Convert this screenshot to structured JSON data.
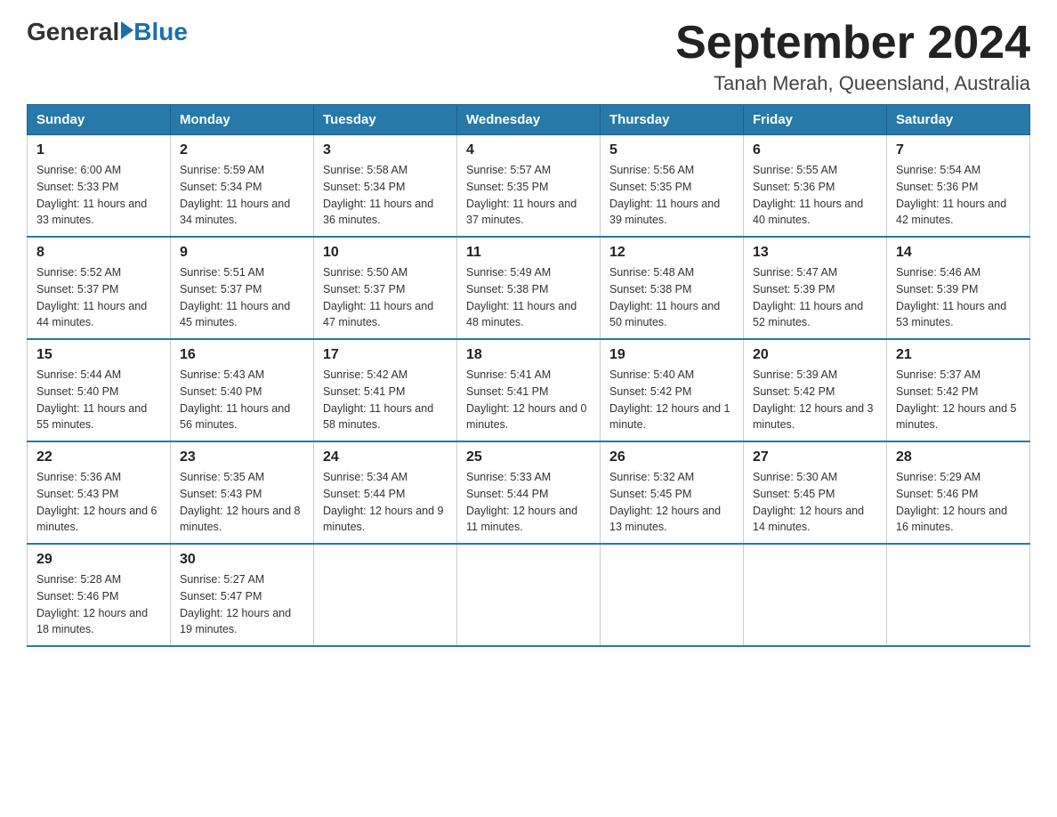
{
  "header": {
    "logo_general": "General",
    "logo_blue": "Blue",
    "month_title": "September 2024",
    "subtitle": "Tanah Merah, Queensland, Australia"
  },
  "calendar": {
    "days_of_week": [
      "Sunday",
      "Monday",
      "Tuesday",
      "Wednesday",
      "Thursday",
      "Friday",
      "Saturday"
    ],
    "weeks": [
      [
        null,
        null,
        null,
        null,
        null,
        null,
        null,
        {
          "day": "1",
          "sunrise": "Sunrise: 6:00 AM",
          "sunset": "Sunset: 5:33 PM",
          "daylight": "Daylight: 11 hours and 33 minutes.",
          "col": 0
        },
        {
          "day": "2",
          "sunrise": "Sunrise: 5:59 AM",
          "sunset": "Sunset: 5:34 PM",
          "daylight": "Daylight: 11 hours and 34 minutes.",
          "col": 1
        },
        {
          "day": "3",
          "sunrise": "Sunrise: 5:58 AM",
          "sunset": "Sunset: 5:34 PM",
          "daylight": "Daylight: 11 hours and 36 minutes.",
          "col": 2
        },
        {
          "day": "4",
          "sunrise": "Sunrise: 5:57 AM",
          "sunset": "Sunset: 5:35 PM",
          "daylight": "Daylight: 11 hours and 37 minutes.",
          "col": 3
        },
        {
          "day": "5",
          "sunrise": "Sunrise: 5:56 AM",
          "sunset": "Sunset: 5:35 PM",
          "daylight": "Daylight: 11 hours and 39 minutes.",
          "col": 4
        },
        {
          "day": "6",
          "sunrise": "Sunrise: 5:55 AM",
          "sunset": "Sunset: 5:36 PM",
          "daylight": "Daylight: 11 hours and 40 minutes.",
          "col": 5
        },
        {
          "day": "7",
          "sunrise": "Sunrise: 5:54 AM",
          "sunset": "Sunset: 5:36 PM",
          "daylight": "Daylight: 11 hours and 42 minutes.",
          "col": 6
        }
      ],
      [
        {
          "day": "8",
          "sunrise": "Sunrise: 5:52 AM",
          "sunset": "Sunset: 5:37 PM",
          "daylight": "Daylight: 11 hours and 44 minutes.",
          "col": 0
        },
        {
          "day": "9",
          "sunrise": "Sunrise: 5:51 AM",
          "sunset": "Sunset: 5:37 PM",
          "daylight": "Daylight: 11 hours and 45 minutes.",
          "col": 1
        },
        {
          "day": "10",
          "sunrise": "Sunrise: 5:50 AM",
          "sunset": "Sunset: 5:37 PM",
          "daylight": "Daylight: 11 hours and 47 minutes.",
          "col": 2
        },
        {
          "day": "11",
          "sunrise": "Sunrise: 5:49 AM",
          "sunset": "Sunset: 5:38 PM",
          "daylight": "Daylight: 11 hours and 48 minutes.",
          "col": 3
        },
        {
          "day": "12",
          "sunrise": "Sunrise: 5:48 AM",
          "sunset": "Sunset: 5:38 PM",
          "daylight": "Daylight: 11 hours and 50 minutes.",
          "col": 4
        },
        {
          "day": "13",
          "sunrise": "Sunrise: 5:47 AM",
          "sunset": "Sunset: 5:39 PM",
          "daylight": "Daylight: 11 hours and 52 minutes.",
          "col": 5
        },
        {
          "day": "14",
          "sunrise": "Sunrise: 5:46 AM",
          "sunset": "Sunset: 5:39 PM",
          "daylight": "Daylight: 11 hours and 53 minutes.",
          "col": 6
        }
      ],
      [
        {
          "day": "15",
          "sunrise": "Sunrise: 5:44 AM",
          "sunset": "Sunset: 5:40 PM",
          "daylight": "Daylight: 11 hours and 55 minutes.",
          "col": 0
        },
        {
          "day": "16",
          "sunrise": "Sunrise: 5:43 AM",
          "sunset": "Sunset: 5:40 PM",
          "daylight": "Daylight: 11 hours and 56 minutes.",
          "col": 1
        },
        {
          "day": "17",
          "sunrise": "Sunrise: 5:42 AM",
          "sunset": "Sunset: 5:41 PM",
          "daylight": "Daylight: 11 hours and 58 minutes.",
          "col": 2
        },
        {
          "day": "18",
          "sunrise": "Sunrise: 5:41 AM",
          "sunset": "Sunset: 5:41 PM",
          "daylight": "Daylight: 12 hours and 0 minutes.",
          "col": 3
        },
        {
          "day": "19",
          "sunrise": "Sunrise: 5:40 AM",
          "sunset": "Sunset: 5:42 PM",
          "daylight": "Daylight: 12 hours and 1 minute.",
          "col": 4
        },
        {
          "day": "20",
          "sunrise": "Sunrise: 5:39 AM",
          "sunset": "Sunset: 5:42 PM",
          "daylight": "Daylight: 12 hours and 3 minutes.",
          "col": 5
        },
        {
          "day": "21",
          "sunrise": "Sunrise: 5:37 AM",
          "sunset": "Sunset: 5:42 PM",
          "daylight": "Daylight: 12 hours and 5 minutes.",
          "col": 6
        }
      ],
      [
        {
          "day": "22",
          "sunrise": "Sunrise: 5:36 AM",
          "sunset": "Sunset: 5:43 PM",
          "daylight": "Daylight: 12 hours and 6 minutes.",
          "col": 0
        },
        {
          "day": "23",
          "sunrise": "Sunrise: 5:35 AM",
          "sunset": "Sunset: 5:43 PM",
          "daylight": "Daylight: 12 hours and 8 minutes.",
          "col": 1
        },
        {
          "day": "24",
          "sunrise": "Sunrise: 5:34 AM",
          "sunset": "Sunset: 5:44 PM",
          "daylight": "Daylight: 12 hours and 9 minutes.",
          "col": 2
        },
        {
          "day": "25",
          "sunrise": "Sunrise: 5:33 AM",
          "sunset": "Sunset: 5:44 PM",
          "daylight": "Daylight: 12 hours and 11 minutes.",
          "col": 3
        },
        {
          "day": "26",
          "sunrise": "Sunrise: 5:32 AM",
          "sunset": "Sunset: 5:45 PM",
          "daylight": "Daylight: 12 hours and 13 minutes.",
          "col": 4
        },
        {
          "day": "27",
          "sunrise": "Sunrise: 5:30 AM",
          "sunset": "Sunset: 5:45 PM",
          "daylight": "Daylight: 12 hours and 14 minutes.",
          "col": 5
        },
        {
          "day": "28",
          "sunrise": "Sunrise: 5:29 AM",
          "sunset": "Sunset: 5:46 PM",
          "daylight": "Daylight: 12 hours and 16 minutes.",
          "col": 6
        }
      ],
      [
        {
          "day": "29",
          "sunrise": "Sunrise: 5:28 AM",
          "sunset": "Sunset: 5:46 PM",
          "daylight": "Daylight: 12 hours and 18 minutes.",
          "col": 0
        },
        {
          "day": "30",
          "sunrise": "Sunrise: 5:27 AM",
          "sunset": "Sunset: 5:47 PM",
          "daylight": "Daylight: 12 hours and 19 minutes.",
          "col": 1
        },
        null,
        null,
        null,
        null,
        null
      ]
    ]
  }
}
